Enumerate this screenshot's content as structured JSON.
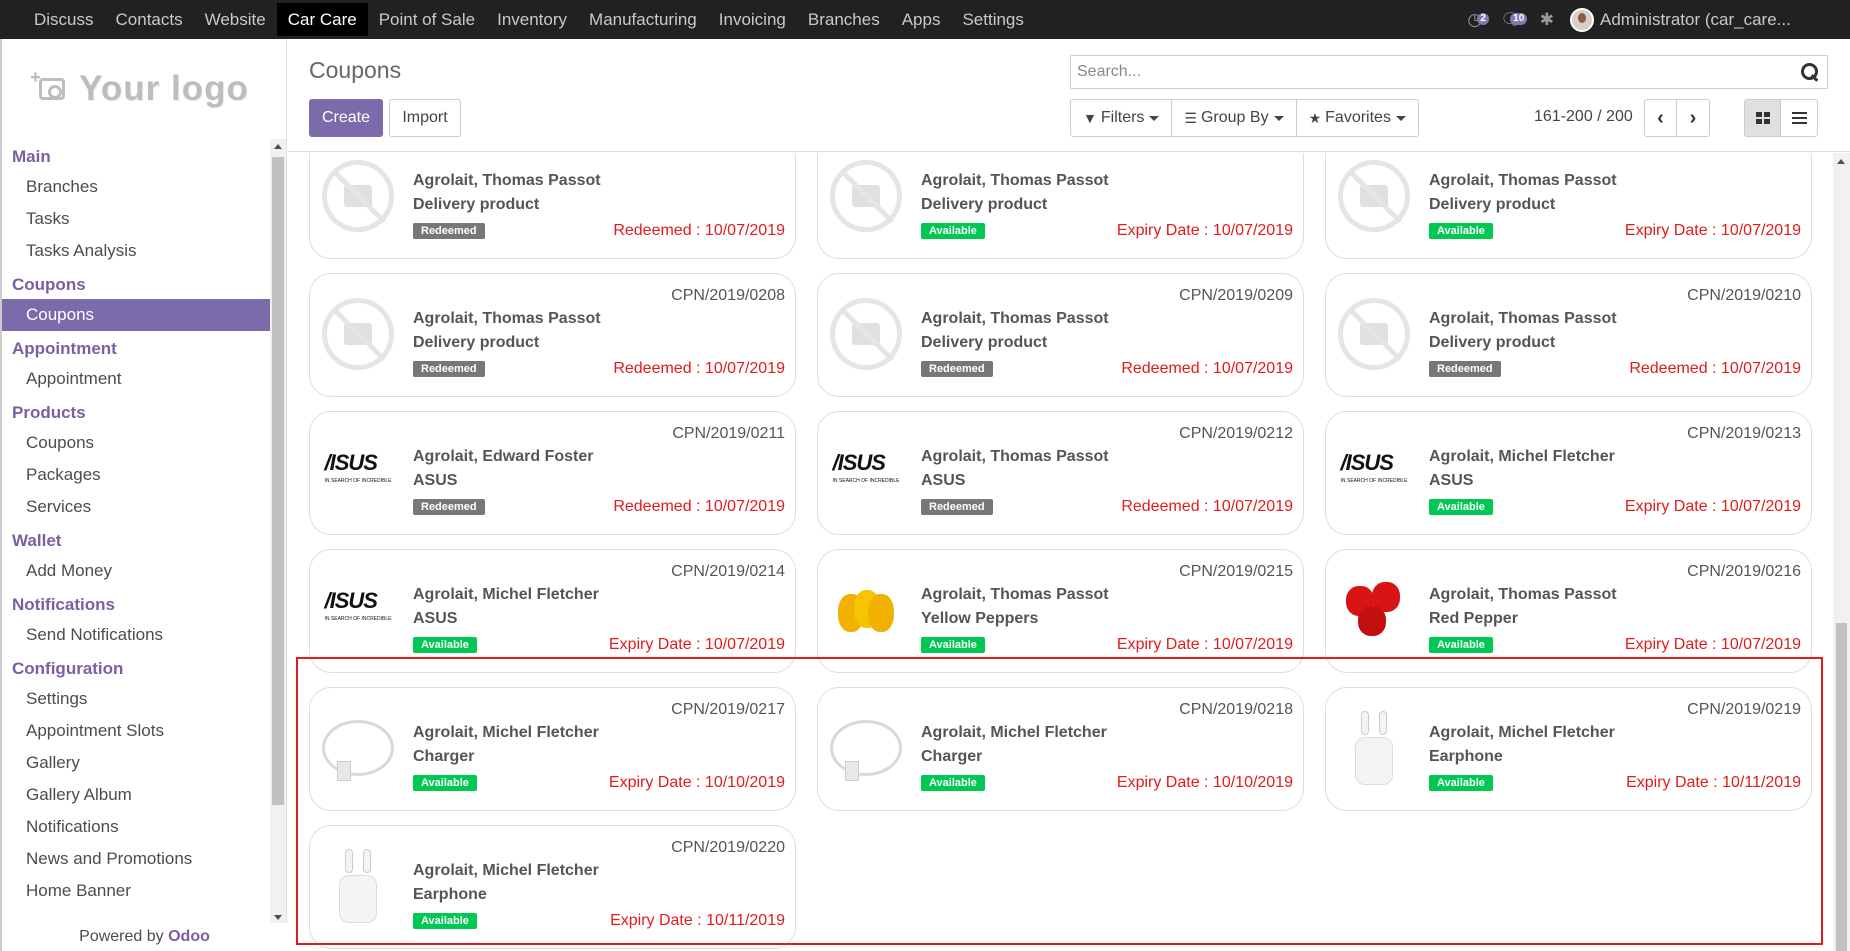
{
  "navbar": {
    "menus": [
      "Discuss",
      "Contacts",
      "Website",
      "Car Care",
      "Point of Sale",
      "Inventory",
      "Manufacturing",
      "Invoicing",
      "Branches",
      "Apps",
      "Settings"
    ],
    "active": "Car Care",
    "activity_count": "2",
    "messages_count": "10",
    "user": "Administrator (car_care..."
  },
  "sidebar": {
    "logo_text": "Your logo",
    "sections": [
      {
        "title": "Main",
        "items": [
          "Branches",
          "Tasks",
          "Tasks Analysis"
        ]
      },
      {
        "title": "Coupons",
        "items": [
          "Coupons"
        ]
      },
      {
        "title": "Appointment",
        "items": [
          "Appointment"
        ]
      },
      {
        "title": "Products",
        "items": [
          "Coupons",
          "Packages",
          "Services"
        ]
      },
      {
        "title": "Wallet",
        "items": [
          "Add Money"
        ]
      },
      {
        "title": "Notifications",
        "items": [
          "Send Notifications"
        ]
      },
      {
        "title": "Configuration",
        "items": [
          "Settings",
          "Appointment Slots",
          "Gallery",
          "Gallery Album",
          "Notifications",
          "News and Promotions",
          "Home Banner"
        ]
      }
    ],
    "active_item": "Coupons",
    "powered_by_prefix": "Powered by",
    "powered_by_brand": "Odoo"
  },
  "control": {
    "title": "Coupons",
    "create_label": "Create",
    "import_label": "Import",
    "search_placeholder": "Search...",
    "filters_label": "Filters",
    "group_by_label": "Group By",
    "favorites_label": "Favorites",
    "pager": "161-200 / 200"
  },
  "colors": {
    "brand": "#7c6bab",
    "available": "#00c853",
    "redeemed": "#777777",
    "date": "#e21b1b",
    "highlight": "#e21b1b"
  },
  "cards": [
    {
      "ref": "",
      "partner": "Agrolait, Thomas Passot",
      "product": "Delivery product",
      "status": "Redeemed",
      "date": "Redeemed : 10/07/2019",
      "image": "no-image-icon"
    },
    {
      "ref": "",
      "partner": "Agrolait, Thomas Passot",
      "product": "Delivery product",
      "status": "Available",
      "date": "Expiry Date : 10/07/2019",
      "image": "no-image-icon"
    },
    {
      "ref": "",
      "partner": "Agrolait, Thomas Passot",
      "product": "Delivery product",
      "status": "Available",
      "date": "Expiry Date : 10/07/2019",
      "image": "no-image-icon"
    },
    {
      "ref": "CPN/2019/0208",
      "partner": "Agrolait, Thomas Passot",
      "product": "Delivery product",
      "status": "Redeemed",
      "date": "Redeemed : 10/07/2019",
      "image": "no-image-icon"
    },
    {
      "ref": "CPN/2019/0209",
      "partner": "Agrolait, Thomas Passot",
      "product": "Delivery product",
      "status": "Redeemed",
      "date": "Redeemed : 10/07/2019",
      "image": "no-image-icon"
    },
    {
      "ref": "CPN/2019/0210",
      "partner": "Agrolait, Thomas Passot",
      "product": "Delivery product",
      "status": "Redeemed",
      "date": "Redeemed : 10/07/2019",
      "image": "no-image-icon"
    },
    {
      "ref": "CPN/2019/0211",
      "partner": "Agrolait, Edward Foster",
      "product": "ASUS",
      "status": "Redeemed",
      "date": "Redeemed : 10/07/2019",
      "image": "asus-logo"
    },
    {
      "ref": "CPN/2019/0212",
      "partner": "Agrolait, Thomas Passot",
      "product": "ASUS",
      "status": "Redeemed",
      "date": "Redeemed : 10/07/2019",
      "image": "asus-logo"
    },
    {
      "ref": "CPN/2019/0213",
      "partner": "Agrolait, Michel Fletcher",
      "product": "ASUS",
      "status": "Available",
      "date": "Expiry Date : 10/07/2019",
      "image": "asus-logo"
    },
    {
      "ref": "CPN/2019/0214",
      "partner": "Agrolait, Michel Fletcher",
      "product": "ASUS",
      "status": "Available",
      "date": "Expiry Date : 10/07/2019",
      "image": "asus-logo"
    },
    {
      "ref": "CPN/2019/0215",
      "partner": "Agrolait, Thomas Passot",
      "product": "Yellow Peppers",
      "status": "Available",
      "date": "Expiry Date : 10/07/2019",
      "image": "yellow-pepper-image"
    },
    {
      "ref": "CPN/2019/0216",
      "partner": "Agrolait, Thomas Passot",
      "product": "Red Pepper",
      "status": "Available",
      "date": "Expiry Date : 10/07/2019",
      "image": "red-pepper-image"
    },
    {
      "ref": "CPN/2019/0217",
      "partner": "Agrolait, Michel Fletcher",
      "product": "Charger",
      "status": "Available",
      "date": "Expiry Date : 10/10/2019",
      "image": "charger-image"
    },
    {
      "ref": "CPN/2019/0218",
      "partner": "Agrolait, Michel Fletcher",
      "product": "Charger",
      "status": "Available",
      "date": "Expiry Date : 10/10/2019",
      "image": "charger-image"
    },
    {
      "ref": "CPN/2019/0219",
      "partner": "Agrolait, Michel Fletcher",
      "product": "Earphone",
      "status": "Available",
      "date": "Expiry Date : 10/11/2019",
      "image": "earphone-image"
    },
    {
      "ref": "CPN/2019/0220",
      "partner": "Agrolait, Michel Fletcher",
      "product": "Earphone",
      "status": "Available",
      "date": "Expiry Date : 10/11/2019",
      "image": "earphone-image"
    }
  ]
}
